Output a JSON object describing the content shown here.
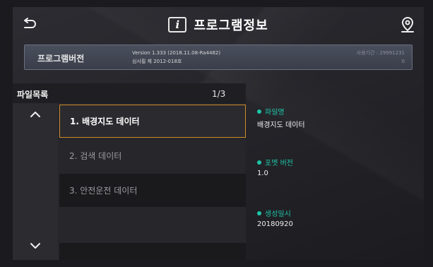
{
  "header": {
    "back_icon": "back-arrow-icon",
    "info_badge": "i",
    "title": "프로그램정보",
    "pin_icon": "location-pin-icon"
  },
  "version": {
    "label": "프로그램버전",
    "line1": "Version 1.333 (2018.11.08-Ra4482)",
    "line2": "심사필 제 2012-018호",
    "expiry_line1": "사용기간 : 29991231",
    "expiry_line2": "0"
  },
  "file_list": {
    "title": "파일목록",
    "page": "1/3",
    "items": [
      {
        "label": "1. 배경지도 데이터"
      },
      {
        "label": "2. 검색 데이터"
      },
      {
        "label": "3. 안전운전 데이터"
      },
      {
        "label": ""
      },
      {
        "label": ""
      }
    ]
  },
  "details": {
    "filename_label": "파일명",
    "filename_value": "배경지도 데이터",
    "format_label": "포멧 버전",
    "format_value": "1.0",
    "created_label": "생성일시",
    "created_value": "20180920"
  },
  "colors": {
    "accent_teal": "#1ec6a8",
    "selection_orange": "#d08a2a"
  }
}
